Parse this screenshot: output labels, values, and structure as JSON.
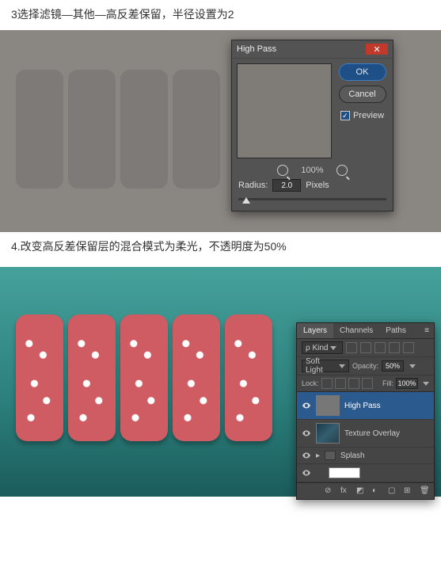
{
  "step3_text": "3选择滤镜—其他—高反差保留，半径设置为2",
  "step4_text": "4.改变高反差保留层的混合模式为柔光，不透明度为50%",
  "high_pass": {
    "title": "High Pass",
    "ok": "OK",
    "cancel": "Cancel",
    "preview_label": "Preview",
    "preview_checked": true,
    "zoom_pct": "100%",
    "radius_label": "Radius:",
    "radius_value": "2.0",
    "radius_unit": "Pixels"
  },
  "layers_panel": {
    "tabs": {
      "layers": "Layers",
      "channels": "Channels",
      "paths": "Paths"
    },
    "kind_label": "ρ Kind",
    "blend_mode": "Soft Light",
    "opacity_label": "Opacity:",
    "opacity_value": "50%",
    "lock_label": "Lock:",
    "fill_label": "Fill:",
    "fill_value": "100%",
    "layers": [
      {
        "name": "High Pass"
      },
      {
        "name": "Texture Overlay"
      },
      {
        "name": "Splash"
      }
    ]
  }
}
